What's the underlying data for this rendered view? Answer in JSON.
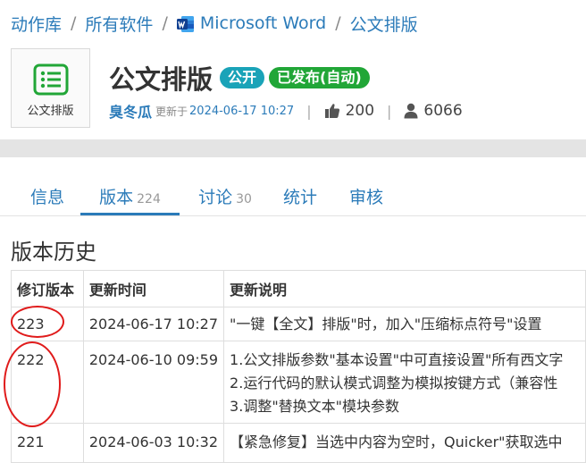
{
  "breadcrumb": {
    "items": [
      "动作库",
      "所有软件",
      "Microsoft Word",
      "公文排版"
    ],
    "separator": "/"
  },
  "app": {
    "icon_name": "list-icon",
    "icon_caption": "公文排版",
    "title": "公文排版",
    "badge_public": "公开",
    "badge_published": "已发布(自动)",
    "author": "臭冬瓜",
    "updated_label": "更新于",
    "updated_date": "2024-06-17 10:27",
    "likes": "200",
    "users": "6066"
  },
  "tabs": [
    {
      "label": "信息",
      "count": ""
    },
    {
      "label": "版本",
      "count": "224"
    },
    {
      "label": "讨论",
      "count": "30"
    },
    {
      "label": "统计",
      "count": ""
    },
    {
      "label": "审核",
      "count": ""
    }
  ],
  "section_title": "版本历史",
  "table": {
    "headers": [
      "修订版本",
      "更新时间",
      "更新说明"
    ],
    "rows": [
      {
        "version": "223",
        "time": "2024-06-17 10:27",
        "lines": [
          "\"一键【全文】排版\"时，加入\"压缩标点符号\"设置"
        ]
      },
      {
        "version": "222",
        "time": "2024-06-10 09:59",
        "lines": [
          "1.公文排版参数\"基本设置\"中可直接设置\"所有西文字",
          "2.运行代码的默认模式调整为模拟按键方式（兼容性",
          "3.调整\"替换文本\"模块参数"
        ]
      },
      {
        "version": "221",
        "time": "2024-06-03 10:32",
        "lines": [
          "【紧急修复】当选中内容为空时，Quicker\"获取选中"
        ]
      }
    ]
  },
  "colors": {
    "link": "#2b7bb9",
    "badge_public": "#1aa3b8",
    "badge_published": "#21a637",
    "annotation": "#e01b1b",
    "icon_green": "#21a637"
  }
}
